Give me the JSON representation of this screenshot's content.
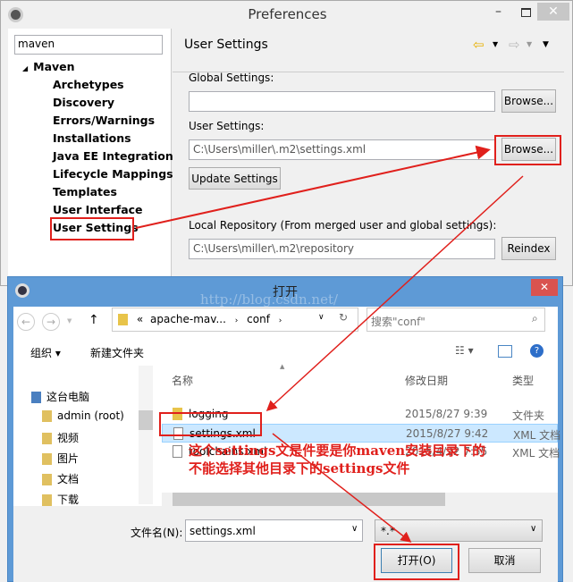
{
  "prefs": {
    "title": "Preferences",
    "search_value": "maven",
    "tree_root": "Maven",
    "tree_items": [
      "Archetypes",
      "Discovery",
      "Errors/Warnings",
      "Installations",
      "Java EE Integration",
      "Lifecycle Mappings",
      "Templates",
      "User Interface",
      "User Settings"
    ],
    "selected": "User Settings",
    "page_title": "User Settings",
    "global_label": "Global Settings:",
    "global_value": "",
    "browse": "Browse...",
    "user_label": "User Settings:",
    "user_value": "C:\\Users\\miller\\.m2\\settings.xml",
    "update": "Update Settings",
    "local_label": "Local Repository (From merged user and global settings):",
    "local_value": "C:\\Users\\miller\\.m2\\repository",
    "reindex": "Reindex"
  },
  "dialog": {
    "title": "打开",
    "watermark": "http://blog.csdn.net/",
    "breadcrumb": [
      "«",
      "apache-mav...",
      "conf"
    ],
    "search_placeholder": "搜索\"conf\"",
    "organize": "组织 ▾",
    "new_folder": "新建文件夹",
    "nav": [
      "这台电脑",
      "admin (root)",
      "视频",
      "图片",
      "文档",
      "下载"
    ],
    "columns": [
      "名称",
      "修改日期",
      "类型"
    ],
    "files": [
      {
        "name": "logging",
        "date": "2015/8/27 9:39",
        "type": "文件夹"
      },
      {
        "name": "settings.xml",
        "date": "2015/8/27 9:42",
        "type": "XML 文档"
      },
      {
        "name": "toolchains.xml",
        "date": "2015/4/22 7:55",
        "type": "XML 文档"
      }
    ],
    "filename_label": "文件名(N):",
    "filename_value": "settings.xml",
    "filter_value": "*.*",
    "open": "打开(O)",
    "cancel": "取消"
  },
  "annotation": {
    "line1": "这个settings文是件要是你maven安装目录下的",
    "line2": "不能选择其他目录下的settings文件",
    "color": "#e0201c"
  }
}
